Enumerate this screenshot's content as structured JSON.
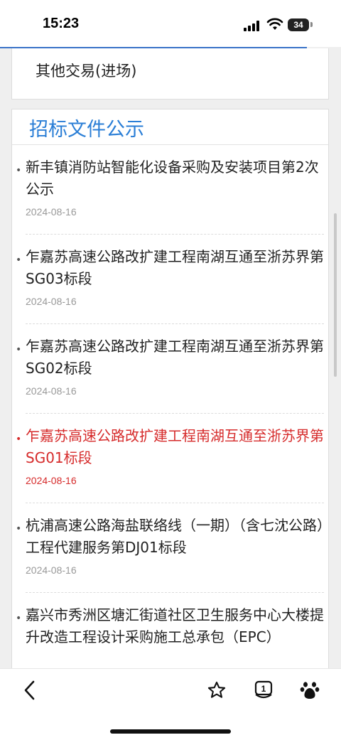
{
  "status_bar": {
    "time": "15:23",
    "battery": "34"
  },
  "other_trade": {
    "label": "其他交易(进场)"
  },
  "section": {
    "title": "招标文件公示",
    "items": [
      {
        "title": "新丰镇消防站智能化设备采购及安装项目第2次公示",
        "date": "2024-08-16"
      },
      {
        "title": "乍嘉苏高速公路改扩建工程南湖互通至浙苏界第SG03标段",
        "date": "2024-08-16"
      },
      {
        "title": "乍嘉苏高速公路改扩建工程南湖互通至浙苏界第SG02标段",
        "date": "2024-08-16"
      },
      {
        "title": "乍嘉苏高速公路改扩建工程南湖互通至浙苏界第SG01标段",
        "date": "2024-08-16"
      },
      {
        "title": "杭浦高速公路海盐联络线（一期）（含七沈公路）工程代建服务第DJ01标段",
        "date": "2024-08-16"
      },
      {
        "title": "嘉兴市秀洲区塘汇街道社区卫生服务中心大楼提升改造工程设计采购施工总承包（EPC）",
        "date": ""
      }
    ]
  },
  "bottom_bar": {
    "tab_count": "1"
  },
  "colors": {
    "accent": "#2a7ed6",
    "highlight": "#d62b2b"
  }
}
